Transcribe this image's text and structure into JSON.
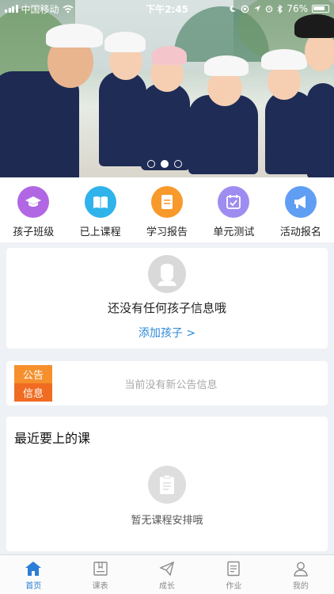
{
  "status_bar": {
    "carrier": "中国移动",
    "time": "下午2:45",
    "battery": "76%"
  },
  "banner": {
    "slide_count": 3,
    "active_slide": 2
  },
  "quick_menu": [
    {
      "label": "孩子班级",
      "icon": "graduation-cap-icon",
      "color": "#b167e3"
    },
    {
      "label": "已上课程",
      "icon": "open-book-icon",
      "color": "#2fb3ea"
    },
    {
      "label": "学习报告",
      "icon": "report-document-icon",
      "color": "#f79a2b"
    },
    {
      "label": "单元测试",
      "icon": "calendar-check-icon",
      "color": "#9f8cf0"
    },
    {
      "label": "活动报名",
      "icon": "megaphone-icon",
      "color": "#5f9ef3"
    }
  ],
  "child_card": {
    "empty_text": "还没有任何孩子信息哦",
    "add_link": "添加孩子 >"
  },
  "notice": {
    "badge_line1": "公告",
    "badge_line2": "信息",
    "empty_text": "当前没有新公告信息"
  },
  "upcoming_courses": {
    "title": "最近要上的课",
    "empty_text": "暂无课程安排哦"
  },
  "tab_bar": [
    {
      "label": "首页",
      "icon": "home-icon",
      "active": true
    },
    {
      "label": "课表",
      "icon": "schedule-icon",
      "active": false
    },
    {
      "label": "成长",
      "icon": "paper-plane-icon",
      "active": false
    },
    {
      "label": "作业",
      "icon": "homework-icon",
      "active": false
    },
    {
      "label": "我的",
      "icon": "profile-icon",
      "active": false
    }
  ],
  "colors": {
    "accent": "#2b7ed6",
    "link": "#2b8ad8",
    "notice_badge_top": "#f5902d",
    "notice_badge_bottom": "#f06c22",
    "tab_inactive": "#8b8b8b"
  }
}
